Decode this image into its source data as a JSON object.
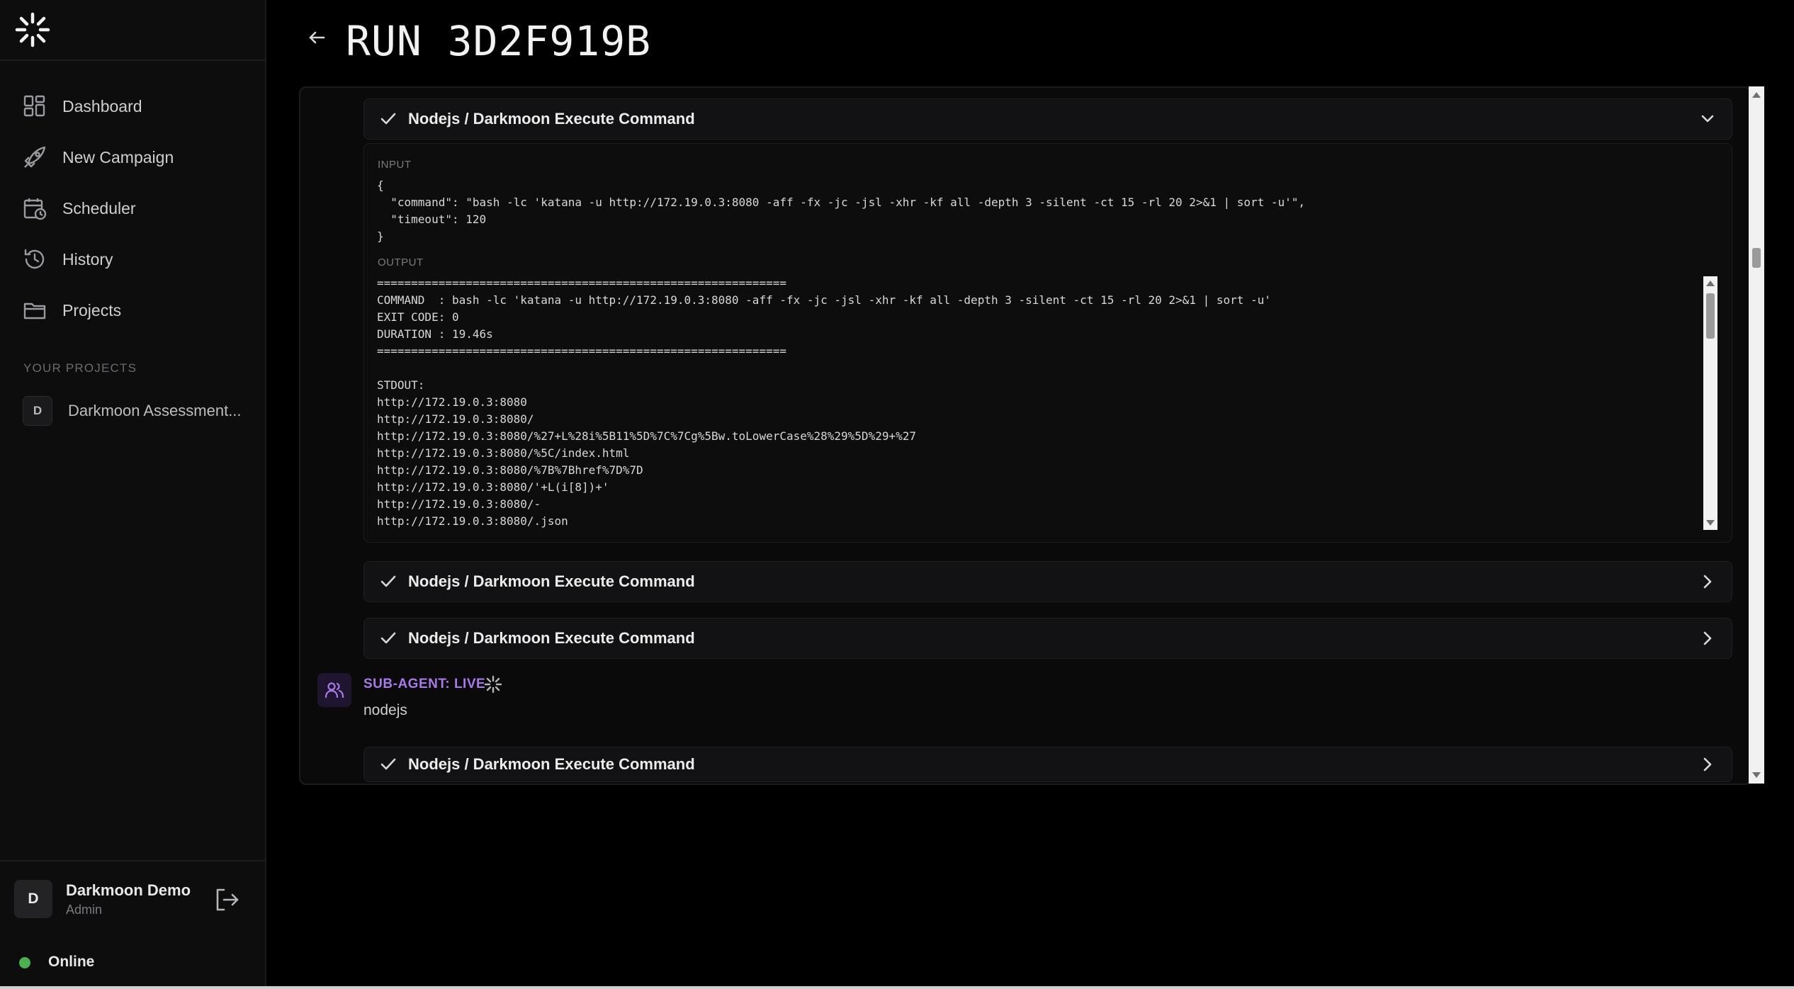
{
  "app": {
    "accent_color": "#a779e9",
    "online_color": "#4caf50"
  },
  "sidebar": {
    "logo_icon": "burst-logo-icon",
    "nav": [
      {
        "label": "Dashboard",
        "icon": "grid-icon"
      },
      {
        "label": "New Campaign",
        "icon": "rocket-icon"
      },
      {
        "label": "Scheduler",
        "icon": "calendar-clock-icon"
      },
      {
        "label": "History",
        "icon": "history-icon"
      },
      {
        "label": "Projects",
        "icon": "folder-icon"
      }
    ],
    "section_title": "YOUR PROJECTS",
    "projects": [
      {
        "badge": "D",
        "name": "Darkmoon Assessment..."
      }
    ],
    "user": {
      "initial": "D",
      "name": "Darkmoon Demo",
      "role": "Admin"
    },
    "status": "Online"
  },
  "header": {
    "title": "RUN 3D2F919B"
  },
  "run": {
    "tool_cards": [
      {
        "title": "Nodejs / Darkmoon Execute Command",
        "expanded": true
      },
      {
        "title": "Nodejs / Darkmoon Execute Command",
        "expanded": false
      },
      {
        "title": "Nodejs / Darkmoon Execute Command",
        "expanded": false
      },
      {
        "title": "Nodejs / Darkmoon Execute Command",
        "expanded": false
      }
    ],
    "input_label": "INPUT",
    "input_lines": [
      "{",
      "  \"command\": \"bash -lc 'katana -u http://172.19.0.3:8080 -aff -fx -jc -jsl -xhr -kf all -depth 3 -silent -ct 15 -rl 20 2>&1 | sort -u'\",",
      "  \"timeout\": 120",
      "}"
    ],
    "output_label": "OUTPUT",
    "output_lines": [
      "============================================================",
      "COMMAND  : bash -lc 'katana -u http://172.19.0.3:8080 -aff -fx -jc -jsl -xhr -kf all -depth 3 -silent -ct 15 -rl 20 2>&1 | sort -u'",
      "EXIT CODE: 0",
      "DURATION : 19.46s",
      "============================================================",
      "",
      "STDOUT:",
      "http://172.19.0.3:8080",
      "http://172.19.0.3:8080/",
      "http://172.19.0.3:8080/%27+L%28i%5B11%5D%7C%7Cg%5Bw.toLowerCase%28%29%5D%29+%27",
      "http://172.19.0.3:8080/%5C/index.html",
      "http://172.19.0.3:8080/%7B%7Bhref%7D%7D",
      "http://172.19.0.3:8080/'+L(i[8])+'",
      "http://172.19.0.3:8080/-",
      "http://172.19.0.3:8080/.json"
    ],
    "sub_agent": {
      "label": "SUB-AGENT: LIVE",
      "name": "nodejs",
      "icon": "users-icon"
    }
  }
}
